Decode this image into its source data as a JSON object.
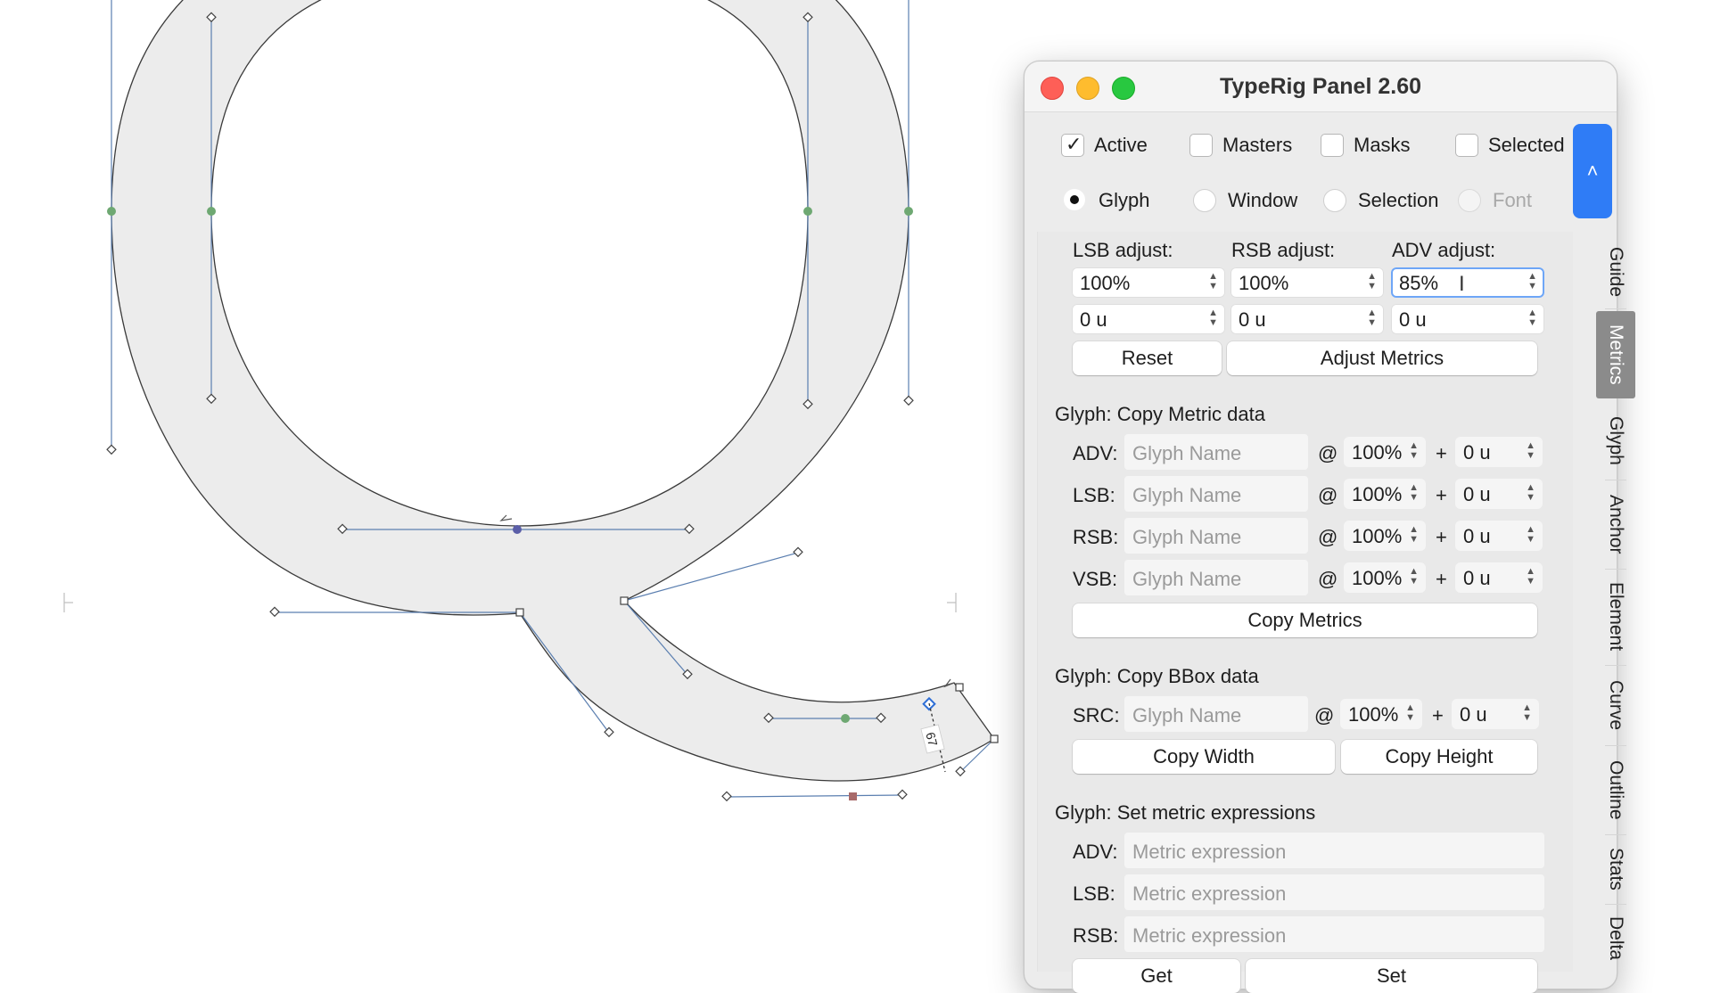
{
  "panel": {
    "title": "TypeRig Panel 2.60",
    "checks": [
      {
        "label": "Active",
        "checked": true
      },
      {
        "label": "Masters",
        "checked": false
      },
      {
        "label": "Masks",
        "checked": false
      },
      {
        "label": "Selected",
        "checked": false
      }
    ],
    "radios": [
      {
        "label": "Glyph",
        "selected": true
      },
      {
        "label": "Window",
        "selected": false
      },
      {
        "label": "Selection",
        "selected": false
      },
      {
        "label": "Font",
        "selected": false,
        "disabled": true
      }
    ],
    "scroll_button": "˄",
    "metrics": {
      "lsb_label": "LSB adjust:",
      "rsb_label": "RSB adjust:",
      "adv_label": "ADV adjust:",
      "lsb_pct": "100%",
      "rsb_pct": "100%",
      "adv_pct": "85%",
      "lsb_units": "0 u",
      "rsb_units": "0 u",
      "adv_units": "0 u",
      "reset": "Reset",
      "adjust": "Adjust Metrics"
    },
    "copy_metric": {
      "title": "Glyph: Copy Metric data",
      "rows": [
        {
          "label": "ADV:",
          "placeholder": "Glyph Name",
          "at": "@",
          "pct": "100%",
          "plus": "+",
          "units": "0 u"
        },
        {
          "label": "LSB:",
          "placeholder": "Glyph Name",
          "at": "@",
          "pct": "100%",
          "plus": "+",
          "units": "0 u"
        },
        {
          "label": "RSB:",
          "placeholder": "Glyph Name",
          "at": "@",
          "pct": "100%",
          "plus": "+",
          "units": "0 u"
        },
        {
          "label": "VSB:",
          "placeholder": "Glyph Name",
          "at": "@",
          "pct": "100%",
          "plus": "+",
          "units": "0 u"
        }
      ],
      "button": "Copy Metrics"
    },
    "copy_bbox": {
      "title": "Glyph: Copy BBox data",
      "label": "SRC:",
      "placeholder": "Glyph Name",
      "at": "@",
      "pct": "100%",
      "plus": "+",
      "units": "0 u",
      "copy_width": "Copy Width",
      "copy_height": "Copy Height"
    },
    "expressions": {
      "title": "Glyph: Set metric expressions",
      "rows": [
        {
          "label": "ADV:",
          "placeholder": "Metric expression"
        },
        {
          "label": "LSB:",
          "placeholder": "Metric expression"
        },
        {
          "label": "RSB:",
          "placeholder": "Metric expression"
        }
      ],
      "get": "Get",
      "set": "Set"
    },
    "tabs": [
      {
        "label": "Guide",
        "selected": false
      },
      {
        "label": "Metrics",
        "selected": true
      },
      {
        "label": "Glyph",
        "selected": false
      },
      {
        "label": "Anchor",
        "selected": false
      },
      {
        "label": "Element",
        "selected": false
      },
      {
        "label": "Curve",
        "selected": false
      },
      {
        "label": "Outline",
        "selected": false
      },
      {
        "label": "Stats",
        "selected": false
      },
      {
        "label": "Delta",
        "selected": false
      }
    ]
  },
  "canvas": {
    "measurement_label": "67",
    "glyph_fill": "#ececec",
    "handle_color": "#5b7fb0",
    "smooth_node_color": "#6ea872"
  }
}
